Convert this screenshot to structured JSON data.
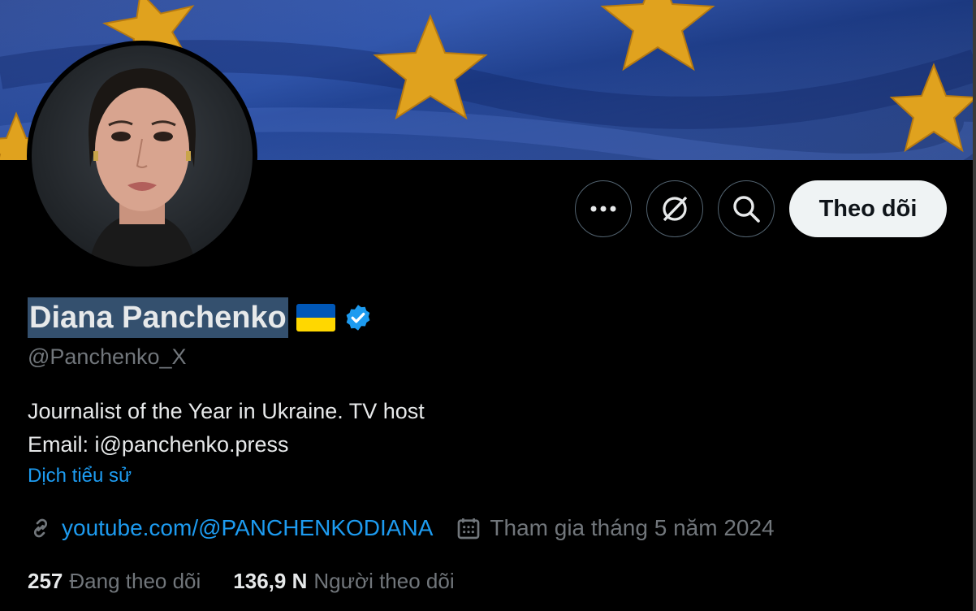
{
  "profile": {
    "name": "Diana Panchenko",
    "handle": "@Panchenko_X",
    "bio_line1": "Journalist of the Year in Ukraine. TV host",
    "bio_line2": "Email: i@panchenko.press",
    "translate_bio": "Dịch tiểu sử",
    "website": "youtube.com/@PANCHENKODIANA",
    "joined": "Tham gia tháng 5 năm 2024",
    "flag_colors": [
      "#0057b7",
      "#ffd700"
    ]
  },
  "actions": {
    "follow_label": "Theo dõi",
    "more_icon": "more-dots-icon",
    "grok_icon": "grok-icon",
    "search_icon": "search-icon"
  },
  "stats": {
    "following_count": "257",
    "following_label": "Đang theo dõi",
    "followers_count": "136,9 N",
    "followers_label": "Người theo dõi"
  },
  "colors": {
    "accent": "#1d9bf0",
    "muted": "#71767b",
    "text": "#e7e9ea",
    "follow_bg": "#eff3f4"
  }
}
